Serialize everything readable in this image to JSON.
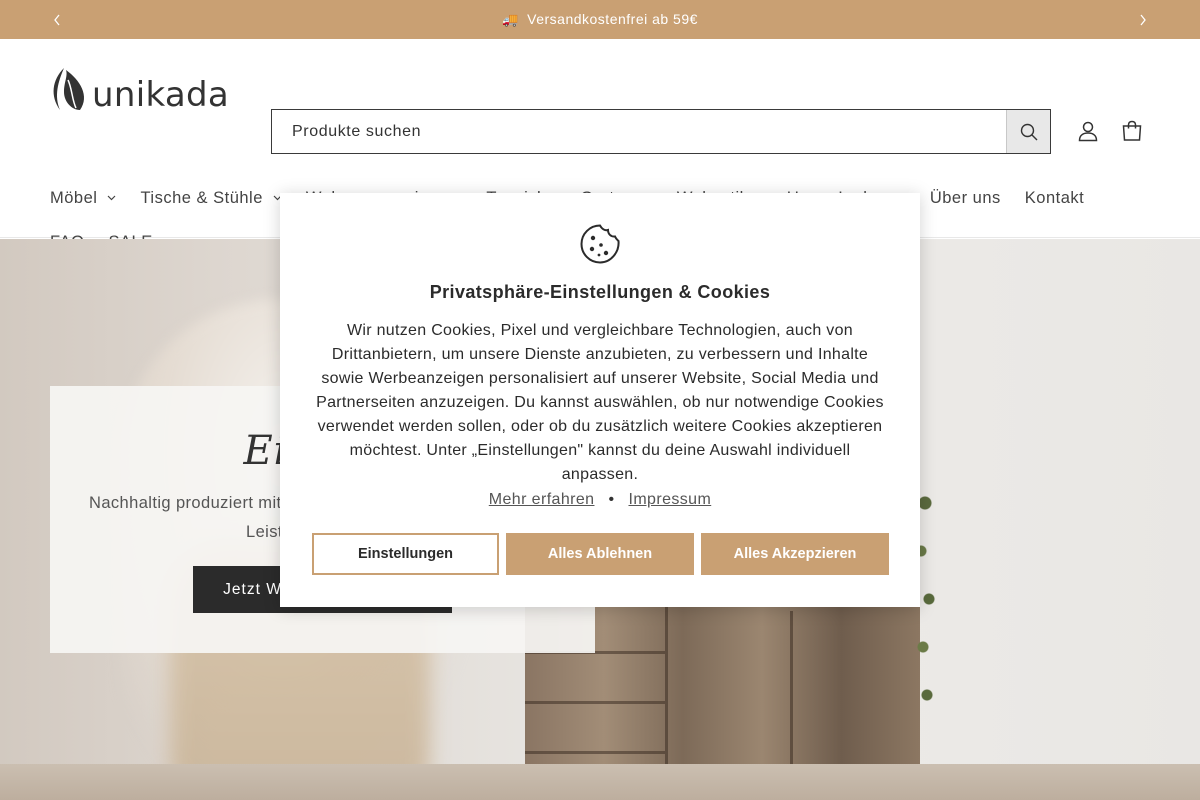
{
  "announcement": {
    "text": "Versandkostenfrei ab 59€",
    "truck_icon": "🚚"
  },
  "brand": {
    "name": "unikada",
    "accent": "#c9a073"
  },
  "search": {
    "placeholder": "Produkte suchen"
  },
  "nav": {
    "items": [
      {
        "label": "Möbel",
        "dropdown": true
      },
      {
        "label": "Tische & Stühle",
        "dropdown": true
      },
      {
        "label": "Wohnaccessoires",
        "dropdown": true
      },
      {
        "label": "Teppiche",
        "dropdown": false
      },
      {
        "label": "Garten",
        "dropdown": true
      },
      {
        "label": "Wohnstil",
        "dropdown": true
      },
      {
        "label": "Unser Laden",
        "dropdown": true
      },
      {
        "label": "Über uns",
        "dropdown": false
      },
      {
        "label": "Kontakt",
        "dropdown": false
      },
      {
        "label": "FAQ",
        "dropdown": false
      },
      {
        "label": "SALE",
        "dropdown": false
      }
    ]
  },
  "hero": {
    "title": "Einziga",
    "subtitle_line1": "Nachhaltig produziert mit",
    "subtitle_line2": "Leist",
    "button_label": "Jetzt W"
  },
  "cookie_modal": {
    "title": "Privatsphäre-Einstellungen & Cookies",
    "body": "Wir nutzen Cookies, Pixel und vergleichbare Technologien, auch von Drittanbietern, um unsere Dienste anzubieten, zu verbessern und Inhalte sowie Werbeanzeigen personalisiert auf unserer Website, Social Media und Partnerseiten anzuzeigen. Du kannst auswählen, ob nur notwendige Cookies verwendet werden sollen, oder ob du zusätzlich weitere Cookies akzeptieren möchtest. Unter „Einstellungen\" kannst du deine Auswahl individuell anpassen.",
    "link_more": "Mehr erfahren",
    "separator": "•",
    "link_imprint": "Impressum",
    "btn_settings": "Einstellungen",
    "btn_reject": "Alles Ablehnen",
    "btn_accept": "Alles Akzepzieren"
  }
}
